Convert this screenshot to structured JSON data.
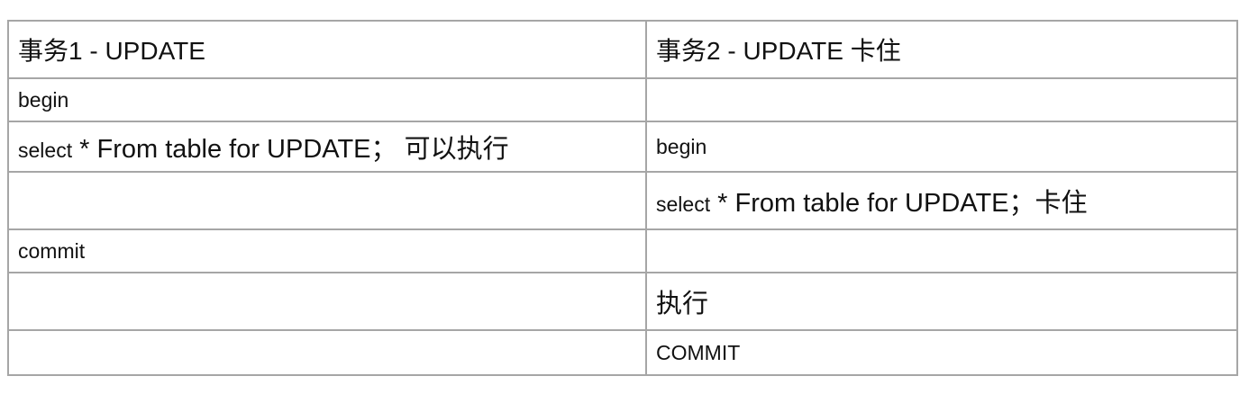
{
  "table": {
    "headers": {
      "tx1": "事务1 - UPDATE",
      "tx2": "事务2 - UPDATE 卡住"
    },
    "rows": [
      {
        "tx1": "begin",
        "tx2": ""
      },
      {
        "tx1_prefix": "select",
        "tx1_main": " * From table for UPDATE； 可以执行",
        "tx2": "begin"
      },
      {
        "tx1": "",
        "tx2_prefix": "select",
        "tx2_main": " * From table for UPDATE；卡住"
      },
      {
        "tx1": "commit",
        "tx2": ""
      },
      {
        "tx1": "",
        "tx2": "执行"
      },
      {
        "tx1": "",
        "tx2": "COMMIT"
      }
    ]
  }
}
